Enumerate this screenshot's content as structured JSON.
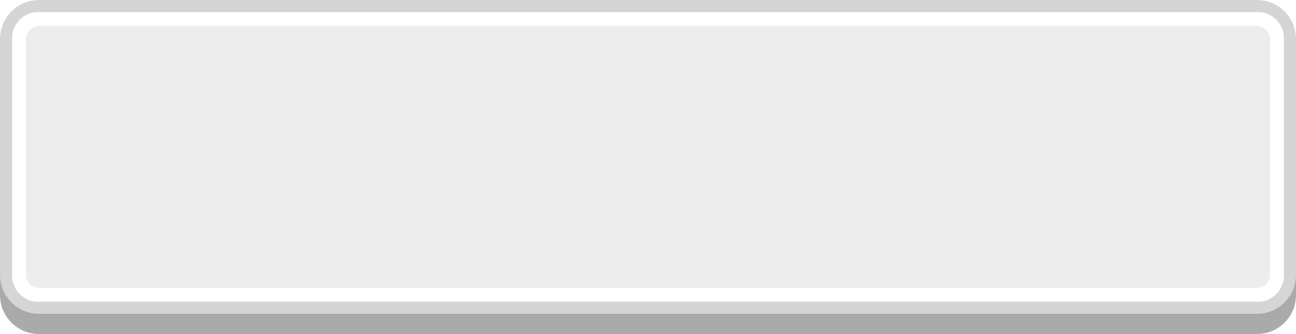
{
  "button": {
    "label": "",
    "colors": {
      "shadow": "#aaaaaa",
      "border": "#d5d5d5",
      "highlight": "#ffffff",
      "face": "#ededed"
    }
  }
}
